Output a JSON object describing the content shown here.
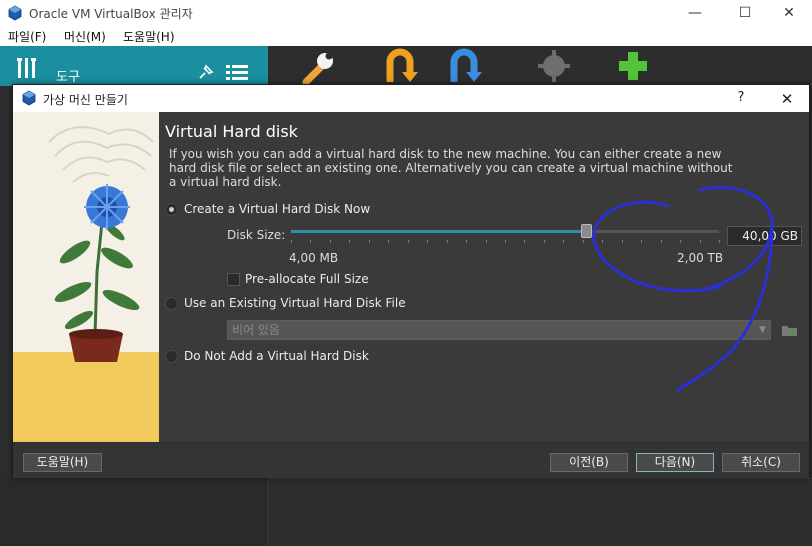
{
  "window": {
    "title": "Oracle VM VirtualBox 관리자",
    "minimize_glyph": "—",
    "maximize_glyph": "☐",
    "close_glyph": "✕"
  },
  "menu": {
    "items": [
      "파일(F)",
      "머신(M)",
      "도움말(H)"
    ]
  },
  "tools_panel": {
    "label": "도구"
  },
  "toolbar": {
    "icons": [
      "settings-wrench-icon",
      "discard-state-icon",
      "start-arrow-icon",
      "machine-gear-icon",
      "add-plus-icon"
    ]
  },
  "dialog": {
    "title": "가상 머신 만들기",
    "help_glyph": "?",
    "close_glyph": "✕",
    "heading": "Virtual Hard disk",
    "description": "If you wish you can add a virtual hard disk to the new machine. You can either create a new hard disk file or select an existing one. Alternatively you can create a virtual machine without a virtual hard disk.",
    "option_create": "Create a Virtual Hard Disk Now",
    "disk_size_label": "Disk Size:",
    "disk_size_value": "40,00 GB",
    "slider_min_label": "4,00 MB",
    "slider_max_label": "2,00 TB",
    "slider_position_fraction": 0.69,
    "preallocate_label": "Pre-allocate Full Size",
    "preallocate_checked": false,
    "option_existing": "Use an Existing Virtual Hard Disk File",
    "existing_file_placeholder": "비어 있음",
    "option_none": "Do Not Add a Virtual Hard Disk",
    "selected_option": "create"
  },
  "buttons": {
    "help": "도움말(H)",
    "back": "이전(B)",
    "next": "다음(N)",
    "cancel": "취소(C)"
  },
  "colors": {
    "accent": "#1a8fa0",
    "dialog_bg": "#3a3a3a",
    "annotation_ink": "#2b2fd6"
  }
}
